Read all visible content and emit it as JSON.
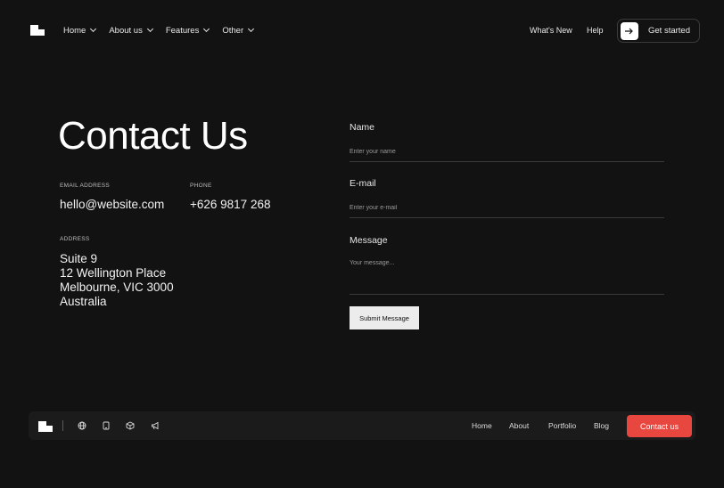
{
  "nav": {
    "items": [
      {
        "label": "Home"
      },
      {
        "label": "About us"
      },
      {
        "label": "Features"
      },
      {
        "label": "Other"
      }
    ],
    "whats_new": "What's New",
    "help": "Help",
    "get_started": "Get started",
    "get_started_icon": "arrow-right-icon"
  },
  "contact": {
    "title": "Contact Us",
    "email_label": "EMAIL ADDRESS",
    "email": "hello@website.com",
    "phone_label": "PHONE",
    "phone": "+626 9817 268",
    "address_label": "ADDRESS",
    "address": [
      "Suite 9",
      "12 Wellington Place",
      "Melbourne, VIC 3000",
      "Australia"
    ]
  },
  "form": {
    "name_label": "Name",
    "name_placeholder": "Enter your name",
    "email_label": "E-mail",
    "email_placeholder": "Enter your e-mail",
    "message_label": "Message",
    "message_placeholder": "Your message...",
    "submit": "Submit Message"
  },
  "footer": {
    "icons": [
      "globe-icon",
      "tablet-icon",
      "cube-icon",
      "megaphone-icon"
    ],
    "links": [
      {
        "label": "Home"
      },
      {
        "label": "About"
      },
      {
        "label": "Portfolio"
      },
      {
        "label": "Blog"
      }
    ],
    "cta": "Contact us",
    "cta_color": "#e8473f"
  }
}
